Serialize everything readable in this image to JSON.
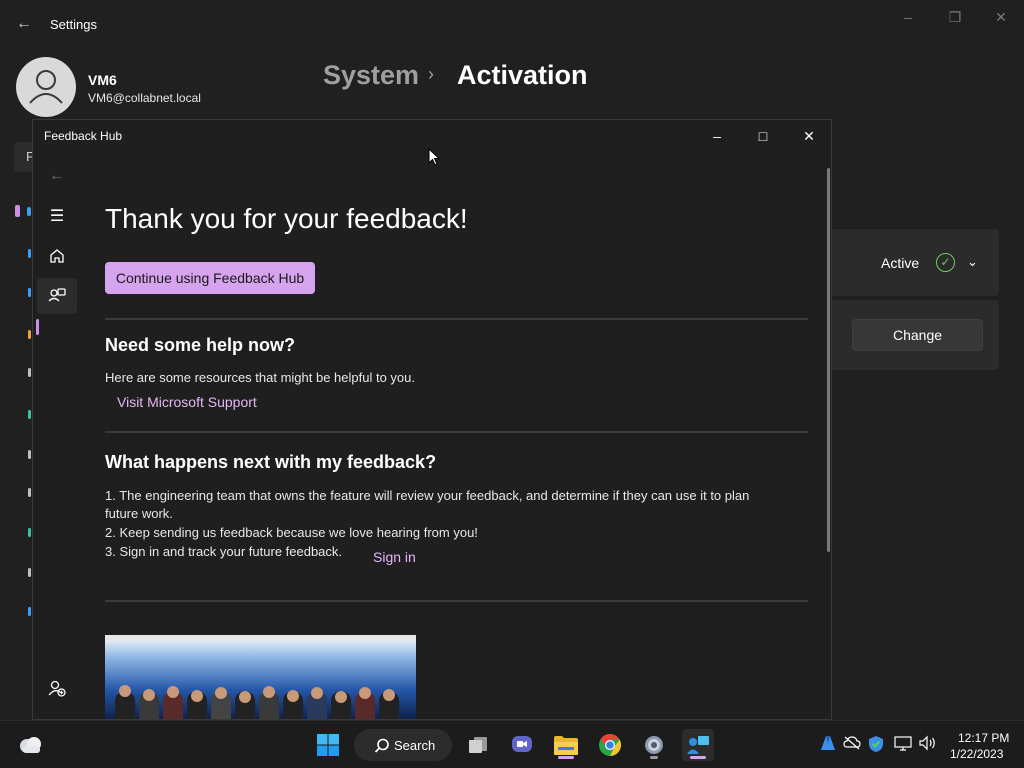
{
  "settings": {
    "app_title": "Settings",
    "user": {
      "name": "VM6",
      "email": "VM6@collabnet.local"
    },
    "breadcrumb": {
      "parent": "System",
      "separator": "›",
      "current": "Activation"
    },
    "activation_state": "Active",
    "change_button": "Change",
    "search_fragment": "F"
  },
  "feedback_hub": {
    "window_title": "Feedback Hub",
    "heading": "Thank you for your feedback!",
    "continue_button": "Continue using Feedback Hub",
    "help_heading": "Need some help now?",
    "help_text": "Here are some resources that might be helpful to you.",
    "support_link": "Visit Microsoft Support",
    "next_heading": "What happens next with my feedback?",
    "next_items": [
      "1. The engineering team that owns the feature will review your feedback, and determine if they can use it to plan",
      "future work.",
      "2. Keep sending us feedback because we love hearing from you!",
      "3. Sign in and track your future feedback."
    ],
    "sign_in_link": "Sign in"
  },
  "taskbar": {
    "search_label": "Search",
    "time": "12:17 PM",
    "date": "1/22/2023"
  },
  "colors": {
    "accent": "#d6a3ee",
    "link": "#e6b6f7",
    "active_check": "#6ccb5f",
    "background": "#202020"
  }
}
